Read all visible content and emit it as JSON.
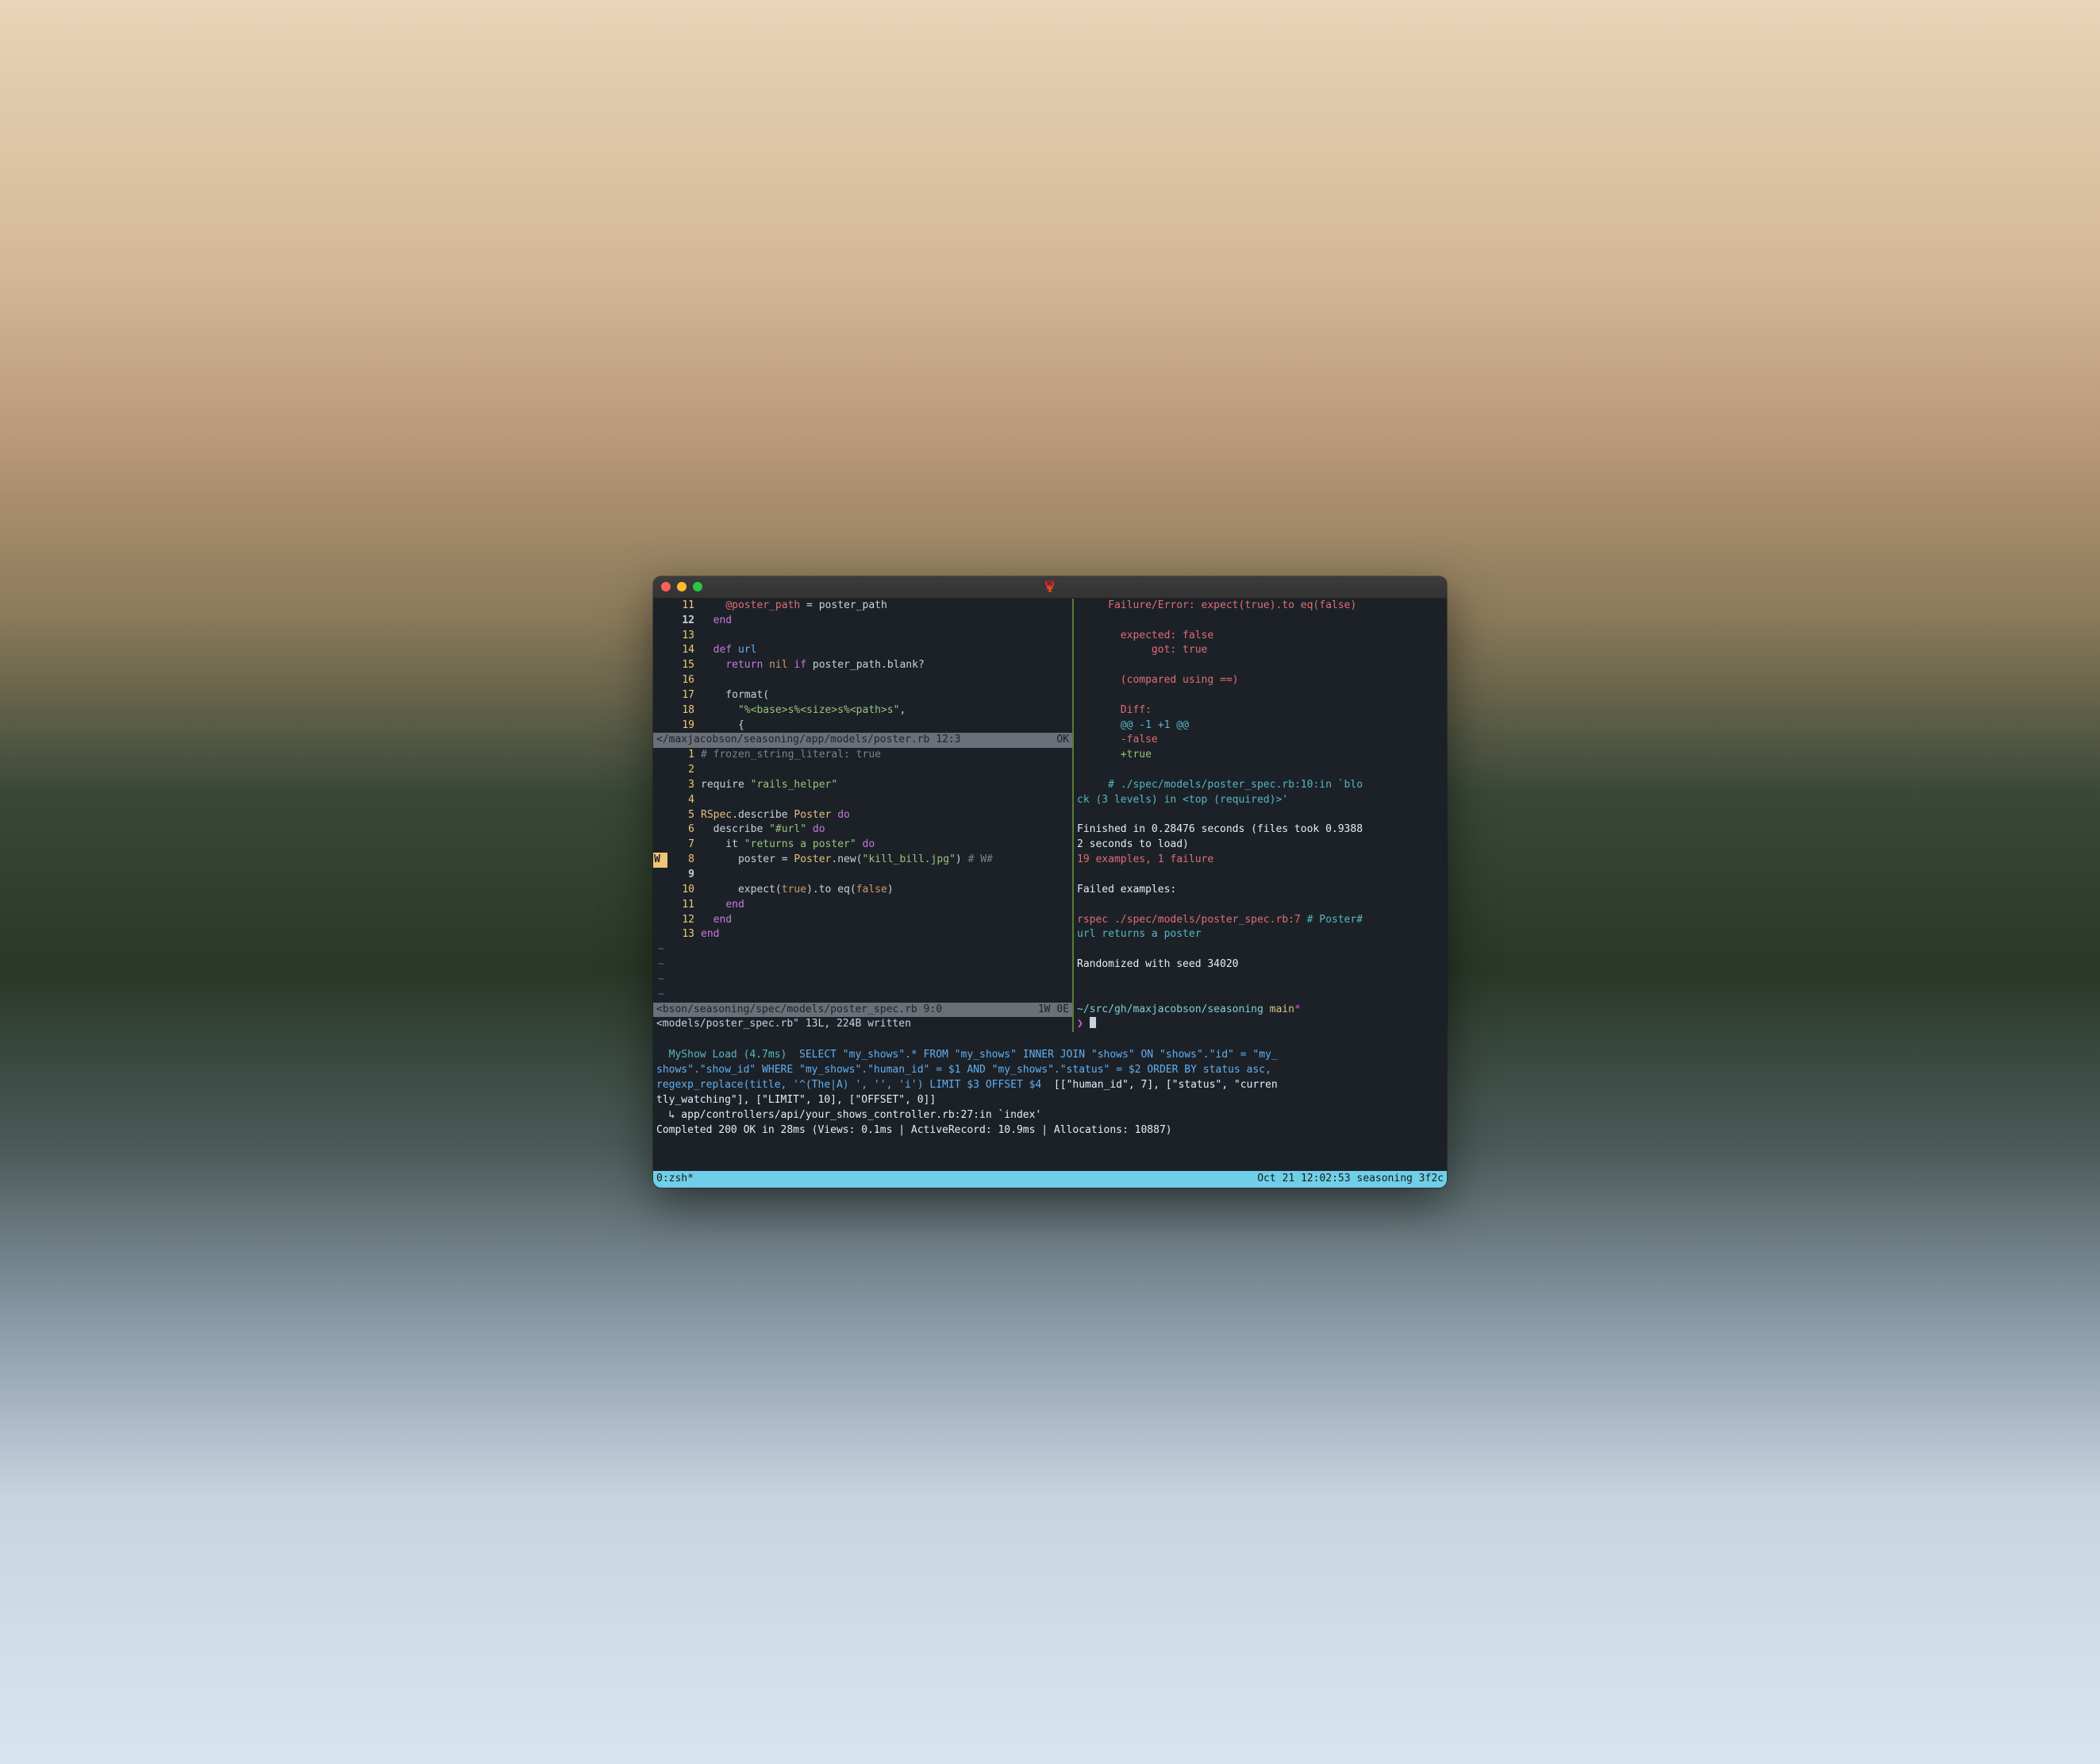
{
  "titlebar": {
    "icon": "🦞"
  },
  "editor_top": {
    "lines": [
      {
        "n": "11",
        "parts": [
          [
            "    ",
            ""
          ],
          [
            "@poster_path",
            "ivar"
          ],
          [
            " = poster_path",
            ""
          ]
        ]
      },
      {
        "n": "12",
        "cur": true,
        "parts": [
          [
            "  ",
            ""
          ],
          [
            "end",
            "kw"
          ]
        ]
      },
      {
        "n": "13",
        "parts": [
          [
            "",
            ""
          ]
        ]
      },
      {
        "n": "14",
        "parts": [
          [
            "  ",
            ""
          ],
          [
            "def ",
            "kw"
          ],
          [
            "url",
            "fn"
          ]
        ]
      },
      {
        "n": "15",
        "parts": [
          [
            "    ",
            ""
          ],
          [
            "return ",
            "kw"
          ],
          [
            "nil ",
            "lit"
          ],
          [
            "if ",
            "kw"
          ],
          [
            "poster_path.blank?",
            ""
          ]
        ]
      },
      {
        "n": "16",
        "parts": [
          [
            "",
            ""
          ]
        ]
      },
      {
        "n": "17",
        "parts": [
          [
            "    format(",
            ""
          ]
        ]
      },
      {
        "n": "18",
        "parts": [
          [
            "      ",
            ""
          ],
          [
            "\"%<base>s%<size>s%<path>s\"",
            "str"
          ],
          [
            ",",
            ""
          ]
        ]
      },
      {
        "n": "19",
        "parts": [
          [
            "      {",
            ""
          ]
        ]
      }
    ],
    "status_left": "</maxjacobson/seasoning/app/models/poster.rb 12:3",
    "status_right": "OK"
  },
  "editor_bottom": {
    "lines": [
      {
        "n": "1",
        "parts": [
          [
            "# frozen_string_literal: true",
            "cmt"
          ]
        ]
      },
      {
        "n": "2",
        "parts": [
          [
            "",
            ""
          ]
        ]
      },
      {
        "n": "3",
        "parts": [
          [
            "require ",
            ""
          ],
          [
            "\"rails_helper\"",
            "str"
          ]
        ]
      },
      {
        "n": "4",
        "parts": [
          [
            "",
            ""
          ]
        ]
      },
      {
        "n": "5",
        "parts": [
          [
            "RSpec",
            "const"
          ],
          [
            ".describe ",
            ""
          ],
          [
            "Poster ",
            "const"
          ],
          [
            "do",
            "kw"
          ]
        ]
      },
      {
        "n": "6",
        "parts": [
          [
            "  describe ",
            ""
          ],
          [
            "\"#url\" ",
            "str"
          ],
          [
            "do",
            "kw"
          ]
        ]
      },
      {
        "n": "7",
        "parts": [
          [
            "    it ",
            ""
          ],
          [
            "\"returns a poster\" ",
            "str"
          ],
          [
            "do",
            "kw"
          ]
        ]
      },
      {
        "n": "8",
        "sign": "W ",
        "parts": [
          [
            "      poster = ",
            ""
          ],
          [
            "Poster",
            "const"
          ],
          [
            ".new(",
            ""
          ],
          [
            "\"kill_bill.jpg\"",
            "str"
          ],
          [
            ") ",
            ""
          ],
          [
            "# W#",
            "cmt"
          ]
        ]
      },
      {
        "n": "9",
        "cur": true,
        "parts": [
          [
            "",
            ""
          ]
        ]
      },
      {
        "n": "10",
        "parts": [
          [
            "      expect(",
            ""
          ],
          [
            "true",
            "lit"
          ],
          [
            ").to eq(",
            ""
          ],
          [
            "false",
            "lit"
          ],
          [
            ")",
            ""
          ]
        ]
      },
      {
        "n": "11",
        "parts": [
          [
            "    ",
            ""
          ],
          [
            "end",
            "kw"
          ]
        ]
      },
      {
        "n": "12",
        "parts": [
          [
            "  ",
            ""
          ],
          [
            "end",
            "kw"
          ]
        ]
      },
      {
        "n": "13",
        "parts": [
          [
            "end",
            "kw"
          ]
        ]
      }
    ],
    "tildes": 4,
    "status_left": "<bson/seasoning/spec/models/poster_spec.rb 9:0",
    "status_right": "1W 0E",
    "cmdline": "<models/poster_spec.rb\" 13L, 224B written"
  },
  "rspec": {
    "lines": [
      [
        [
          "     Failure/Error: expect(true).to eq(false)",
          "err"
        ]
      ],
      [
        [
          "",
          ""
        ]
      ],
      [
        [
          "       expected: false",
          "err"
        ]
      ],
      [
        [
          "            got: true",
          "err"
        ]
      ],
      [
        [
          "",
          ""
        ]
      ],
      [
        [
          "       (compared using ==)",
          "err"
        ]
      ],
      [
        [
          "",
          ""
        ]
      ],
      [
        [
          "       Diff:",
          "err"
        ]
      ],
      [
        [
          "       ",
          ""
        ],
        [
          "@@ -1 +1 @@",
          "cyan"
        ]
      ],
      [
        [
          "       ",
          ""
        ],
        [
          "-false",
          "err"
        ]
      ],
      [
        [
          "       ",
          ""
        ],
        [
          "+true",
          "green"
        ]
      ],
      [
        [
          "",
          ""
        ]
      ],
      [
        [
          "     ",
          ""
        ],
        [
          "# ./spec/models/poster_spec.rb:10:in `blo",
          "cyan"
        ]
      ],
      [
        [
          "ck (3 levels) in <top (required)>'",
          "cyan"
        ]
      ],
      [
        [
          "",
          ""
        ]
      ],
      [
        [
          "Finished in 0.28476 seconds (files took 0.9388",
          "white"
        ]
      ],
      [
        [
          "2 seconds to load)",
          "white"
        ]
      ],
      [
        [
          "19 examples, 1 failure",
          "err"
        ]
      ],
      [
        [
          "",
          ""
        ]
      ],
      [
        [
          "Failed examples:",
          "white"
        ]
      ],
      [
        [
          "",
          ""
        ]
      ],
      [
        [
          "rspec ./spec/models/poster_spec.rb:7 ",
          "err"
        ],
        [
          "# Poster#",
          "cyan"
        ]
      ],
      [
        [
          "url returns a poster",
          "cyan"
        ]
      ],
      [
        [
          "",
          ""
        ]
      ],
      [
        [
          "Randomized with seed 34020",
          "white"
        ]
      ],
      [
        [
          "",
          ""
        ]
      ],
      [
        [
          "",
          ""
        ]
      ]
    ],
    "prompt_path": "~/src/gh/maxjacobson/seasoning",
    "prompt_branch": " main",
    "prompt_dirty": "*",
    "prompt_char": "❯"
  },
  "log": {
    "lines": [
      [
        [
          "  MyShow Load (4.7ms)  ",
          "cyan"
        ],
        [
          "SELECT \"my_shows\".* FROM \"my_shows\" INNER JOIN \"shows\" ON \"shows\".\"id\" = \"my_",
          "blue"
        ]
      ],
      [
        [
          "shows\".\"show_id\" WHERE \"my_shows\".\"human_id\" = $1 AND \"my_shows\".\"status\" = $2 ORDER BY status asc,",
          "blue"
        ]
      ],
      [
        [
          "regexp_replace(title, '^(The|A) ', '', 'i') LIMIT $3 OFFSET $4",
          "blue"
        ],
        [
          "  [[\"human_id\", 7], [\"status\", \"curren",
          "white"
        ]
      ],
      [
        [
          "tly_watching\"], [\"LIMIT\", 10], [\"OFFSET\", 0]]",
          "white"
        ]
      ],
      [
        [
          "  ↳ app/controllers/api/your_shows_controller.rb:27:in `index'",
          "white"
        ]
      ],
      [
        [
          "Completed 200 OK in 28ms (Views: 0.1ms | ActiveRecord: 10.9ms | Allocations: 10887)",
          "white"
        ]
      ]
    ]
  },
  "tmux": {
    "left": "0:zsh*",
    "right": "Oct 21 12:02:53 seasoning 3f2c"
  }
}
